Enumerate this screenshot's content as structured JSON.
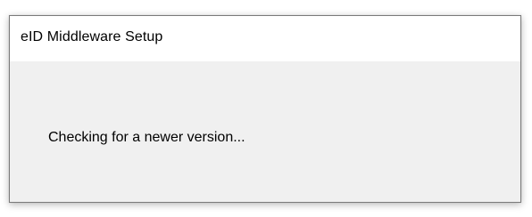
{
  "window": {
    "title": "eID Middleware Setup"
  },
  "content": {
    "status_text": "Checking for a newer version..."
  }
}
